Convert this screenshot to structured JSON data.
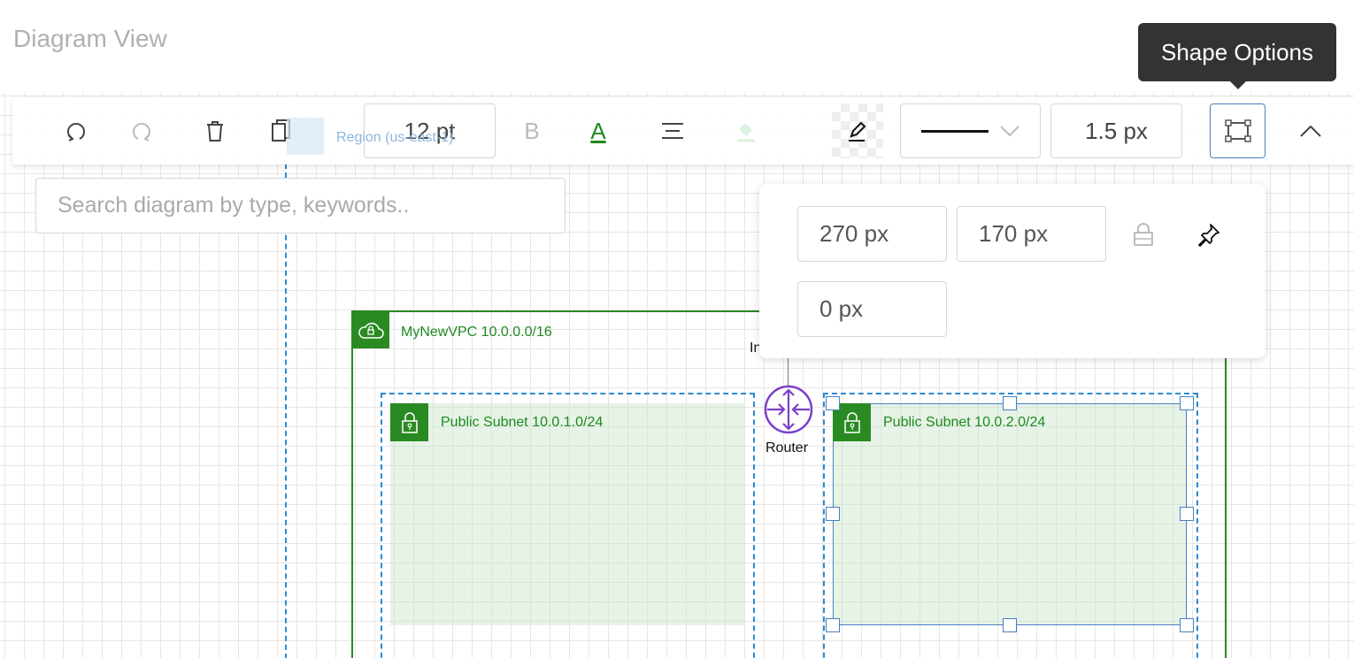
{
  "header": {
    "title": "Diagram View"
  },
  "toolbar": {
    "undo": "undo-icon",
    "redo": "redo-icon",
    "delete": "trash-icon",
    "copy": "copy-icon",
    "font_size": "12 pt",
    "bold": "B",
    "font_color_label": "A",
    "font_color": "#1e8a1e",
    "line_width": "1.5 px"
  },
  "tooltip": {
    "text": "Shape Options"
  },
  "search": {
    "placeholder": "Search diagram by type, keywords.."
  },
  "shape_options": {
    "width": "270 px",
    "height": "170 px",
    "rotation": "0 px"
  },
  "diagram": {
    "region_label": "Region (us-east-1)",
    "vpc_label": "MyNewVPC 10.0.0.0/16",
    "internet_label": "In",
    "router_label": "Router",
    "subnet1_label": "Public Subnet 10.0.1.0/24",
    "subnet2_label": "Public Subnet 10.0.2.0/24",
    "colors": {
      "vpc": "#2a8a22",
      "subnet_fill": "#e8f3e8",
      "router": "#7b3fc9",
      "selection": "#4a7fc0",
      "region": "#2d8bd0"
    }
  }
}
